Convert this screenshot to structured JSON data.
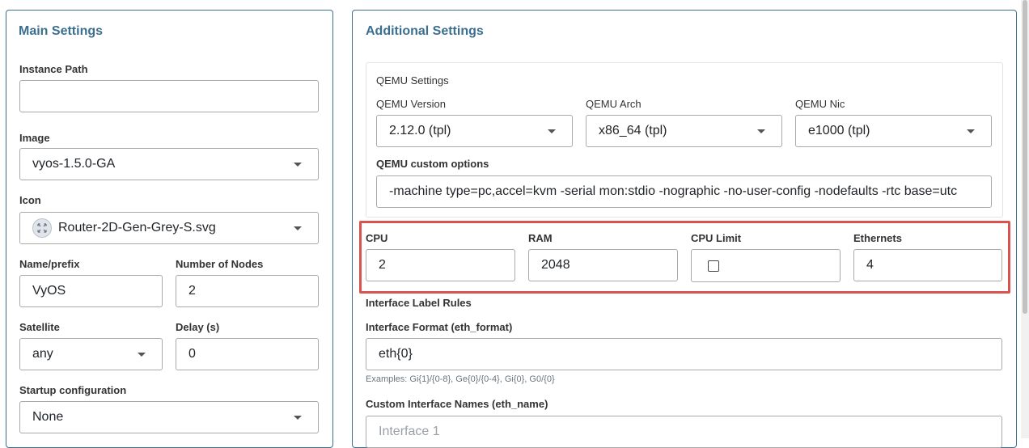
{
  "main": {
    "title": "Main Settings",
    "instance_path": {
      "label": "Instance Path",
      "value": ""
    },
    "image": {
      "label": "Image",
      "value": "vyos-1.5.0-GA"
    },
    "icon": {
      "label": "Icon",
      "value": "Router-2D-Gen-Grey-S.svg"
    },
    "name_prefix": {
      "label": "Name/prefix",
      "value": "VyOS"
    },
    "number_of_nodes": {
      "label": "Number of Nodes",
      "value": "2"
    },
    "satellite": {
      "label": "Satellite",
      "value": "any"
    },
    "delay": {
      "label": "Delay (s)",
      "value": "0"
    },
    "startup_configuration": {
      "label": "Startup configuration",
      "value": "None"
    }
  },
  "additional": {
    "title": "Additional Settings",
    "qemu": {
      "section_title": "QEMU Settings",
      "version": {
        "label": "QEMU Version",
        "value": "2.12.0 (tpl)"
      },
      "arch": {
        "label": "QEMU Arch",
        "value": "x86_64 (tpl)"
      },
      "nic": {
        "label": "QEMU Nic",
        "value": "e1000 (tpl)"
      },
      "custom_options": {
        "label": "QEMU custom options",
        "value": "-machine type=pc,accel=kvm -serial mon:stdio -nographic -no-user-config -nodefaults -rtc base=utc"
      }
    },
    "cpu": {
      "label": "CPU",
      "value": "2"
    },
    "ram": {
      "label": "RAM",
      "value": "2048"
    },
    "cpu_limit": {
      "label": "CPU Limit",
      "checked": false
    },
    "ethernets": {
      "label": "Ethernets",
      "value": "4"
    },
    "interface_label_rules": "Interface Label Rules",
    "interface_format": {
      "label": "Interface Format (eth_format)",
      "value": "eth{0}",
      "hint": "Examples: Gi{1}/{0-8}, Ge{0}/{0-4}, Gi{0}, G0/{0}"
    },
    "custom_interface_names": {
      "label": "Custom Interface Names (eth_name)",
      "placeholder": "Interface 1"
    }
  },
  "colors": {
    "accent": "#3b6f8f",
    "highlight": "#d9534f",
    "border": "#a9a9a9"
  }
}
